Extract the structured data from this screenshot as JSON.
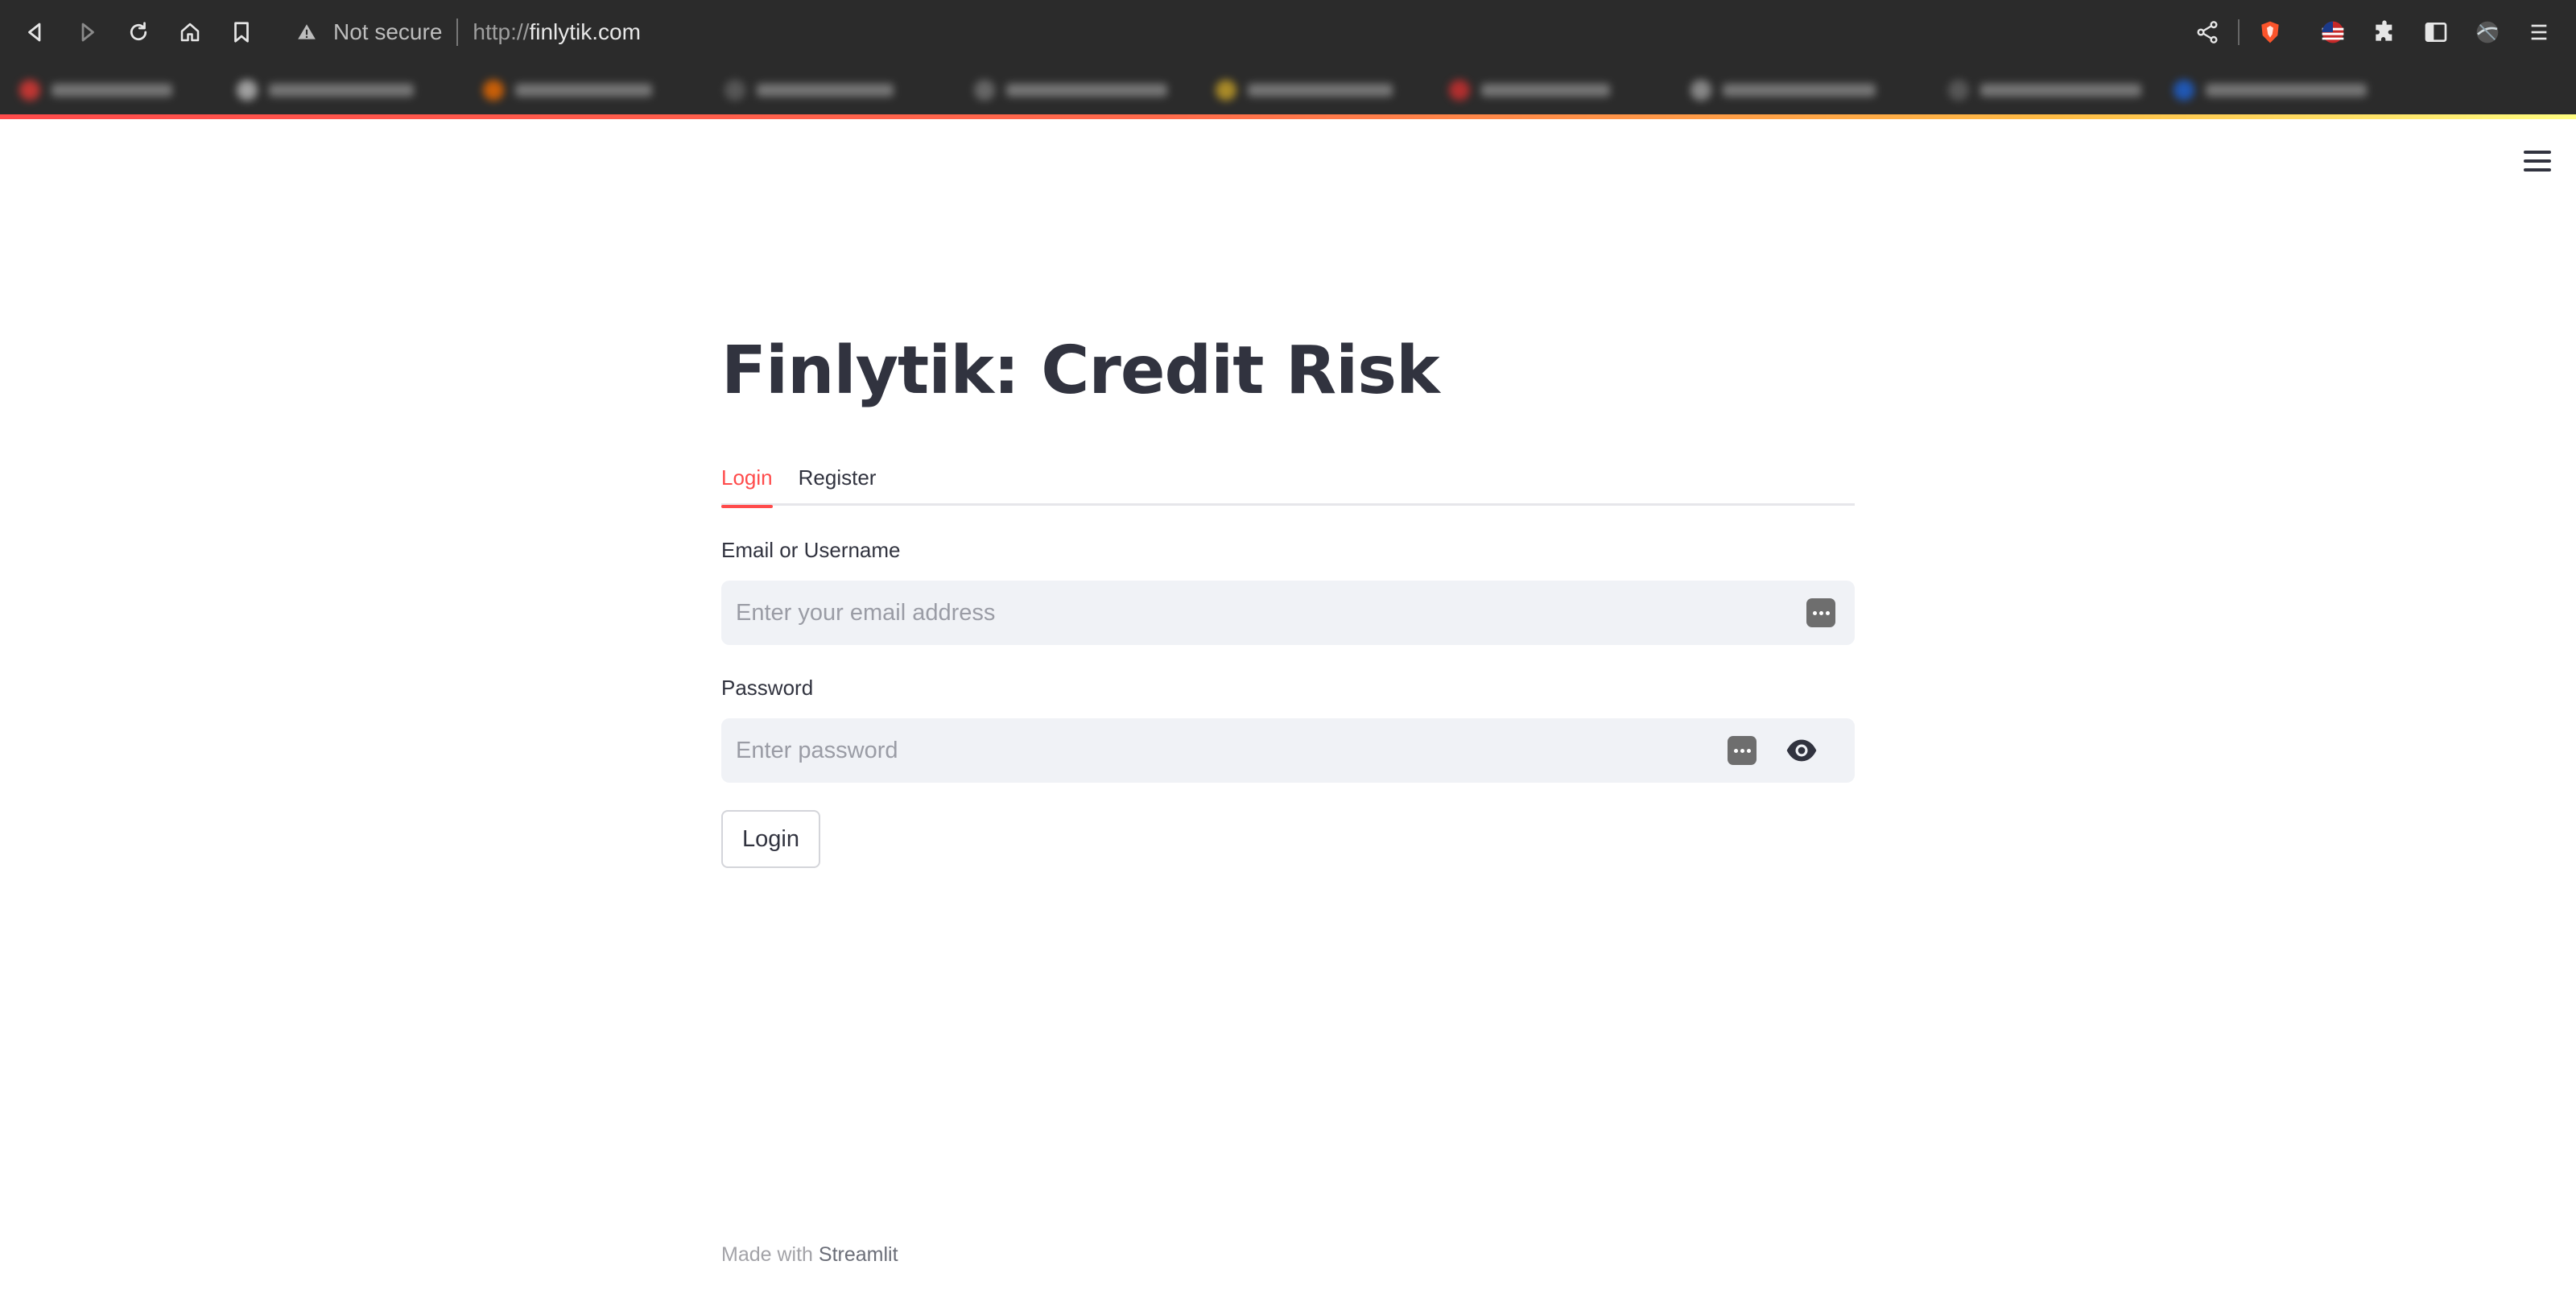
{
  "browser": {
    "security_label": "Not secure",
    "url_scheme": "http://",
    "url_host": "finlytik.com",
    "icons": {
      "back": "back-icon",
      "forward": "forward-icon",
      "reload": "reload-icon",
      "home": "home-icon",
      "bookmark": "bookmark-icon",
      "warning": "warning-icon",
      "share": "share-icon",
      "brave_shield": "brave-shield-icon",
      "flag": "us-flag-icon",
      "extensions": "puzzle-icon",
      "sidebar": "sidebar-icon",
      "profile": "profile-avatar",
      "menu": "kebab-menu-icon"
    }
  },
  "app": {
    "title": "Finlytik: Credit Risk",
    "tabs": [
      {
        "label": "Login",
        "active": true
      },
      {
        "label": "Register",
        "active": false
      }
    ],
    "email": {
      "label": "Email or Username",
      "placeholder": "Enter your email address",
      "value": ""
    },
    "password": {
      "label": "Password",
      "placeholder": "Enter password",
      "value": ""
    },
    "login_button": "Login",
    "footer_prefix": "Made with",
    "footer_brand": "Streamlit",
    "accent_color": "#ff4b4b",
    "text_color": "#31333f",
    "input_bg": "#f0f2f6"
  }
}
